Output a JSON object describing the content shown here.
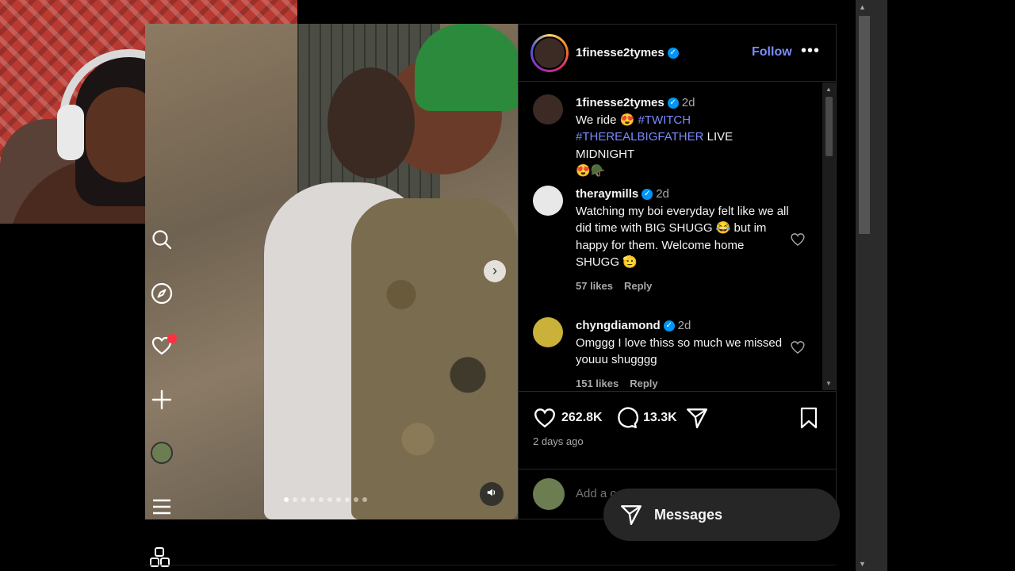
{
  "post": {
    "username": "1finesse2tymes",
    "follow_label": "Follow",
    "more_label": "•••",
    "likes": "262.8K",
    "comments_count": "13.3K",
    "posted": "2 days ago",
    "carousel_dots": 10,
    "carousel_active": 1
  },
  "caption": {
    "username": "1finesse2tymes",
    "time": "2d",
    "text_1": "We ride 😍",
    "tag_1": "#TWITCH",
    "tag_2": "#THEREALBIGFATHER",
    "text_2": "LIVE MIDNIGHT",
    "text_3": "😍🪖"
  },
  "comments": [
    {
      "username": "theraymills",
      "time": "2d",
      "text": "Watching my boi everyday felt like we all did time with BIG SHUGG 😂 but im happy for them. Welcome home SHUGG 🫡",
      "likes": "57 likes",
      "reply": "Reply"
    },
    {
      "username": "chyngdiamond",
      "time": "2d",
      "text": "Omggg I love thiss so much we missed youuu shugggg",
      "likes": "151 likes",
      "reply": "Reply"
    }
  ],
  "add_comment_placeholder": "Add a comment...",
  "messages_label": "Messages",
  "icons": {
    "search": "search-icon",
    "explore": "compass-icon",
    "notifications": "heart-icon",
    "create": "plus-icon",
    "menu": "hamburger-icon",
    "apps": "apps-grid-icon",
    "like": "heart-icon",
    "comment": "comment-icon",
    "share": "send-icon",
    "save": "bookmark-icon"
  },
  "colors": {
    "accent": "#7a8cff",
    "verified": "#0095f6",
    "notification": "#ff3040"
  }
}
